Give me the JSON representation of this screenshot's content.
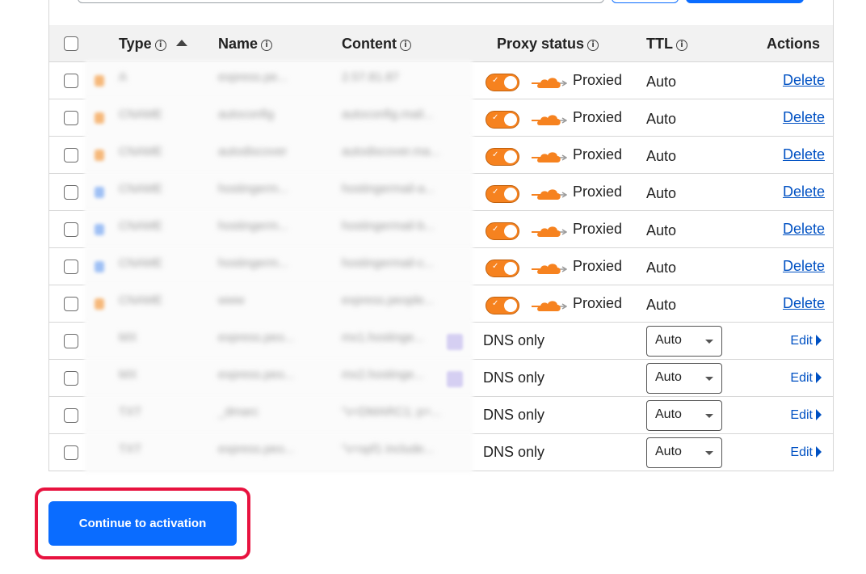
{
  "table": {
    "headers": {
      "type": "Type",
      "name": "Name",
      "content": "Content",
      "proxy_status": "Proxy status",
      "ttl": "TTL",
      "actions": "Actions"
    },
    "info_icon": "info-icon",
    "sort_icon": "sort-ascending-icon",
    "rows": [
      {
        "type": "A",
        "name": "express.pe...",
        "content": "2.57.81.87",
        "dot_color": "#f6b87a",
        "proxy": "Proxied",
        "ttl": "Auto",
        "action": "Delete"
      },
      {
        "type": "CNAME",
        "name": "autoconfig",
        "content": "autoconfig.mail...",
        "dot_color": "#f6b87a",
        "proxy": "Proxied",
        "ttl": "Auto",
        "action": "Delete"
      },
      {
        "type": "CNAME",
        "name": "autodiscover",
        "content": "autodiscover.ma...",
        "dot_color": "#f6b87a",
        "proxy": "Proxied",
        "ttl": "Auto",
        "action": "Delete"
      },
      {
        "type": "CNAME",
        "name": "hostingerm...",
        "content": "hostingermail-a...",
        "dot_color": "#9fc0f5",
        "proxy": "Proxied",
        "ttl": "Auto",
        "action": "Delete"
      },
      {
        "type": "CNAME",
        "name": "hostingerm...",
        "content": "hostingermail-b...",
        "dot_color": "#9fc0f5",
        "proxy": "Proxied",
        "ttl": "Auto",
        "action": "Delete"
      },
      {
        "type": "CNAME",
        "name": "hostingerm...",
        "content": "hostingermail-c...",
        "dot_color": "#9fc0f5",
        "proxy": "Proxied",
        "ttl": "Auto",
        "action": "Delete"
      },
      {
        "type": "CNAME",
        "name": "www",
        "content": "express.people...",
        "dot_color": "#f6b87a",
        "proxy": "Proxied",
        "ttl": "Auto",
        "action": "Delete"
      },
      {
        "type": "MX",
        "name": "express.peo...",
        "content": "mx1.hostinge...",
        "proxy": "DNS only",
        "ttl": "Auto",
        "action": "Edit"
      },
      {
        "type": "MX",
        "name": "express.peo...",
        "content": "mx2.hostinge...",
        "proxy": "DNS only",
        "ttl": "Auto",
        "action": "Edit"
      },
      {
        "type": "TXT",
        "name": "_dmarc",
        "content": "\"v=DMARC1; p=...",
        "proxy": "DNS only",
        "ttl": "Auto",
        "action": "Edit"
      },
      {
        "type": "TXT",
        "name": "express.peo...",
        "content": "\"v=spf1 include...",
        "proxy": "DNS only",
        "ttl": "Auto",
        "action": "Edit"
      }
    ]
  },
  "icons": {
    "toggle": "toggle-on-icon",
    "cloud": "orange-cloud-icon",
    "caret": "chevron-down-icon",
    "edit_arrow": "triangle-right-icon"
  },
  "colors": {
    "accent": "#0a6cff",
    "proxy_orange": "#f6821f",
    "link": "#0051c3",
    "highlight": "#e8123f"
  },
  "footer": {
    "continue_label": "Continue to activation"
  }
}
